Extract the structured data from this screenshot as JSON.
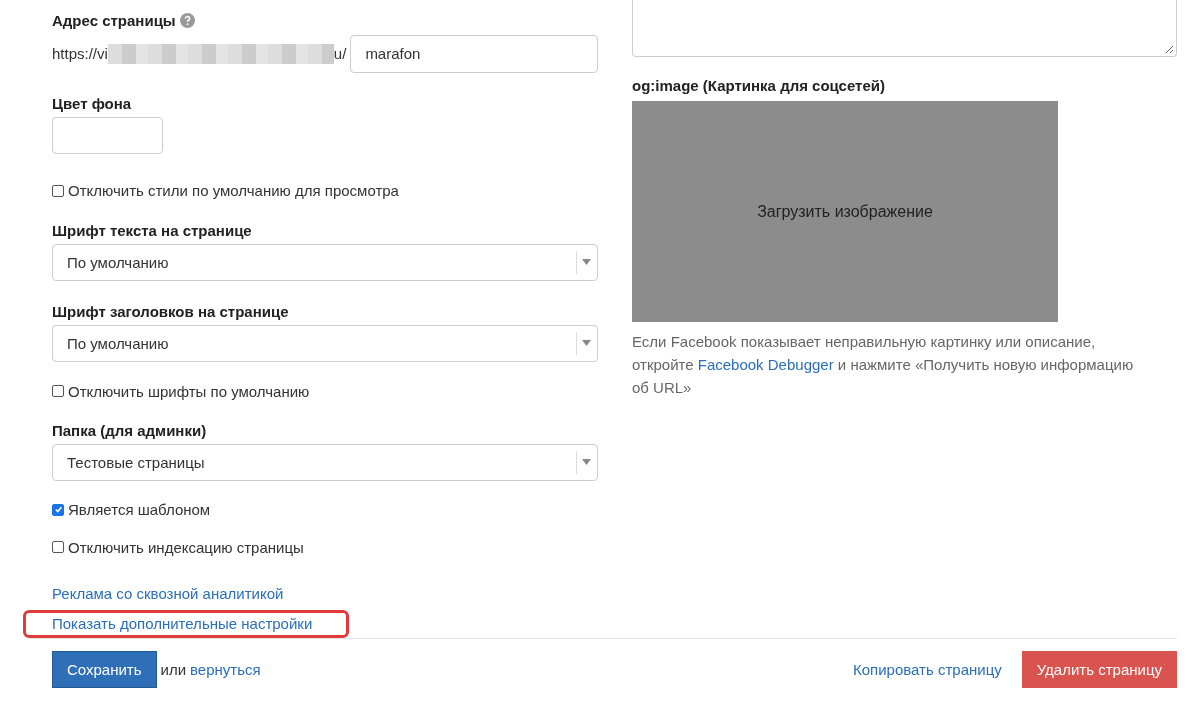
{
  "left_fields": [
    {
      "kind": "label",
      "text": "Адрес страницы",
      "help": true
    },
    {
      "kind": "url",
      "prefix": "https://vi",
      "suffix": "u/",
      "value": "marafon"
    },
    {
      "kind": "label",
      "text": "Цвет фона",
      "help": false
    },
    {
      "kind": "color"
    },
    {
      "kind": "checkbox",
      "text": "Отключить стили по умолчанию для просмотра",
      "checked": false
    },
    {
      "kind": "label",
      "text": "Шрифт текста на странице",
      "help": false
    },
    {
      "kind": "select",
      "value": "По умолчанию"
    },
    {
      "kind": "label",
      "text": "Шрифт заголовков на странице",
      "help": false
    },
    {
      "kind": "select",
      "value": "По умолчанию"
    },
    {
      "kind": "checkbox",
      "text": "Отключить шрифты по умолчанию",
      "checked": false
    },
    {
      "kind": "label",
      "text": "Папка (для админки)",
      "help": false
    },
    {
      "kind": "select",
      "value": "Тестовые страницы"
    },
    {
      "kind": "checkbox",
      "text": "Является шаблоном",
      "checked": true
    },
    {
      "kind": "checkbox",
      "text": "Отключить индексацию страницы",
      "checked": false
    },
    {
      "kind": "link",
      "text": "Реклама со сквозной аналитикой",
      "highlighted": false
    },
    {
      "kind": "link",
      "text": "Показать дополнительные настройки",
      "highlighted": true
    }
  ],
  "og_image": {
    "label": "og:image (Картинка для соцсетей)",
    "upload_text": "Загрузить изображение",
    "hint_before": "Если Facebook показывает неправильную картинку или описание, откройте ",
    "hint_link": "Facebook Debugger",
    "hint_after": " и нажмите «Получить новую информацию об URL»"
  },
  "footer": {
    "save": "Сохранить",
    "or": "или",
    "back": "вернуться",
    "copy": "Копировать страницу",
    "delete": "Удалить страницу"
  }
}
